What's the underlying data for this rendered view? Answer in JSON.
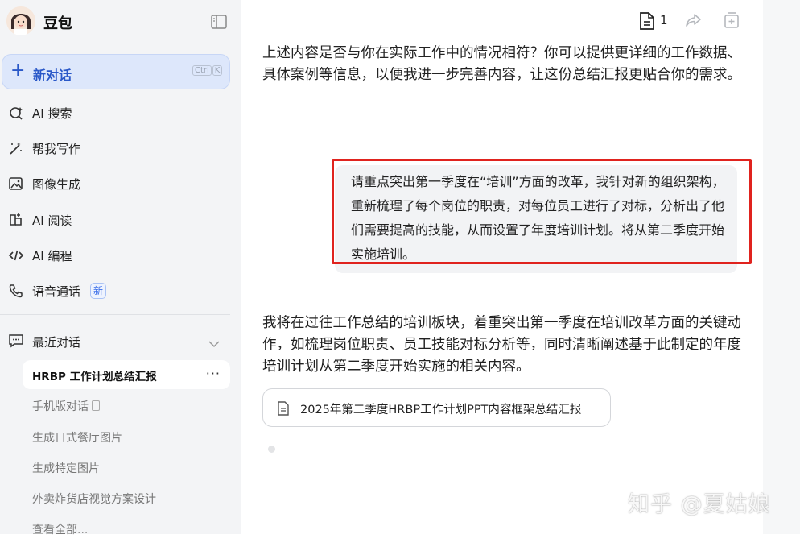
{
  "app": {
    "name": "豆包"
  },
  "sidebar": {
    "new_chat": {
      "label": "新对话",
      "shortcut": [
        "Ctrl",
        "K"
      ]
    },
    "nav": [
      {
        "label": "AI 搜索",
        "icon": "search-spark-icon"
      },
      {
        "label": "帮我写作",
        "icon": "pen-icon"
      },
      {
        "label": "图像生成",
        "icon": "image-icon"
      },
      {
        "label": "AI 阅读",
        "icon": "book-icon"
      },
      {
        "label": "AI 编程",
        "icon": "code-icon"
      },
      {
        "label": "语音通话",
        "icon": "phone-icon",
        "badge": "新"
      }
    ],
    "recent": {
      "title": "最近对话",
      "items": [
        {
          "label": "HRBP 工作计划总结汇报",
          "active": true
        },
        {
          "label": "手机版对话",
          "phone": true
        },
        {
          "label": "生成日式餐厅图片"
        },
        {
          "label": "生成特定图片"
        },
        {
          "label": "外卖炸货店视觉方案设计"
        },
        {
          "label": "查看全部..."
        }
      ]
    }
  },
  "toolbar": {
    "doc_count": "1"
  },
  "chat": {
    "assistant_msg_1": "上述内容是否与你在实际工作中的情况相符？你可以提供更详细的工作数据、具体案例等信息，以便我进一步完善内容，让这份总结汇报更贴合你的需求。",
    "user_msg": "请重点突出第一季度在“培训”方面的改革，我针对新的组织架构，重新梳理了每个岗位的职责，对每位员工进行了对标，分析出了他们需要提高的技能，从而设置了年度培训计划。将从第二季度开始实施培训。",
    "assistant_msg_2": "我将在过往工作总结的培训板块，着重突出第一季度在培训改革方面的关键动作，如梳理岗位职责、员工技能对标分析等，同时清晰阐述基于此制定的年度培训计划从第二季度开始实施的相关内容。",
    "doc_card": "2025年第二季度HRBP工作计划PPT内容框架总结汇报"
  },
  "watermark": "知乎 @夏姑娘",
  "colors": {
    "accent": "#2a58c8",
    "highlight": "#e0231e"
  }
}
